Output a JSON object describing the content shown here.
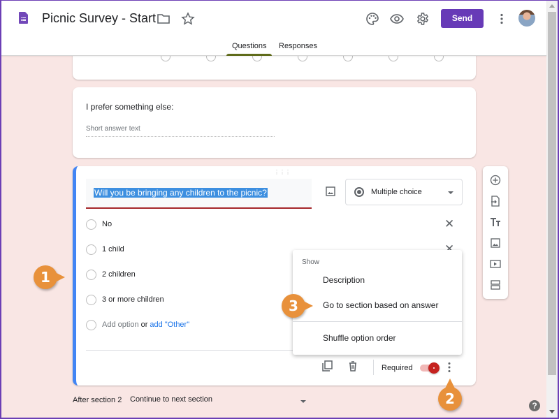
{
  "app": {
    "title": "Picnic Survey - Start",
    "send_label": "Send",
    "icons": {
      "doc": "forms-doc-icon",
      "folder": "folder-icon",
      "star": "star-icon",
      "palette": "palette-icon",
      "preview": "eye-icon",
      "settings": "gear-icon",
      "more": "more-vert-icon",
      "avatar": "user-avatar"
    },
    "accent_color": "#673ab7"
  },
  "tabs": [
    {
      "label": "Questions",
      "active": true
    },
    {
      "label": "Responses",
      "active": false
    }
  ],
  "cards": {
    "else_question": {
      "title": "I prefer something else:",
      "placeholder": "Short answer text"
    },
    "active_question": {
      "title": "Will you be bringing any children to the picnic?",
      "type": "Multiple choice",
      "options": [
        {
          "label": "No"
        },
        {
          "label": "1 child"
        },
        {
          "label": "2 children"
        },
        {
          "label": "3 or more children"
        }
      ],
      "add_option": "Add option",
      "or": "or",
      "add_other": "add \"Other\"",
      "required_label": "Required",
      "required": true,
      "highlight_color": "#4285f4"
    }
  },
  "menu": {
    "heading": "Show",
    "items": [
      {
        "label": "Description"
      },
      {
        "label": "Go to section based on answer"
      },
      {
        "label": "Shuffle option order"
      }
    ]
  },
  "side_toolbar": [
    {
      "name": "add-question-icon",
      "title": "Add question"
    },
    {
      "name": "import-questions-icon",
      "title": "Import questions"
    },
    {
      "name": "add-title-icon",
      "title": "Add title and description"
    },
    {
      "name": "add-image-icon",
      "title": "Add image"
    },
    {
      "name": "add-video-icon",
      "title": "Add video"
    },
    {
      "name": "add-section-icon",
      "title": "Add section"
    }
  ],
  "after_section": {
    "label": "After section 2",
    "value": "Continue to next section"
  },
  "callouts": [
    "1",
    "2",
    "3"
  ],
  "help": "?"
}
